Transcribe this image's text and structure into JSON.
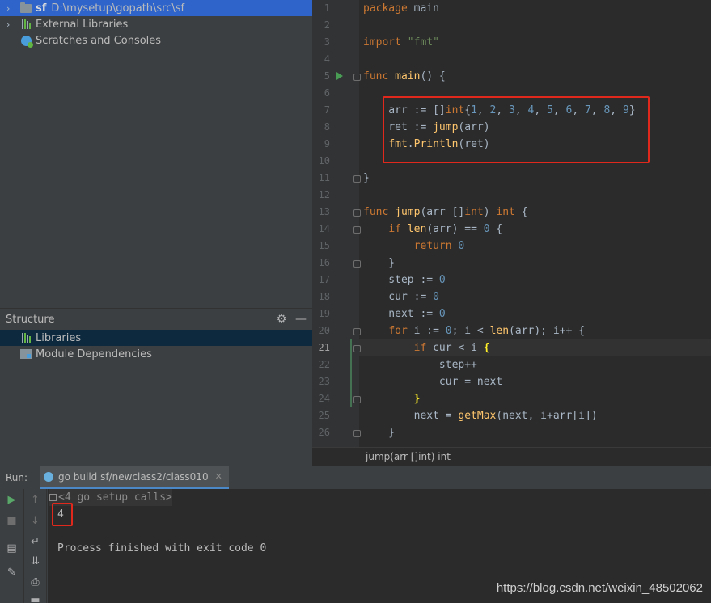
{
  "project": {
    "root_name": "sf",
    "root_path": "D:\\mysetup\\gopath\\src\\sf",
    "items": [
      "External Libraries",
      "Scratches and Consoles"
    ]
  },
  "structure": {
    "title": "Structure",
    "items": [
      "Libraries",
      "Module Dependencies"
    ]
  },
  "editor": {
    "line_numbers": [
      "1",
      "2",
      "3",
      "4",
      "5",
      "6",
      "7",
      "8",
      "9",
      "10",
      "11",
      "12",
      "13",
      "14",
      "15",
      "16",
      "17",
      "18",
      "19",
      "20",
      "21",
      "22",
      "23",
      "24",
      "25",
      "26"
    ],
    "current_line": 21
  },
  "breadcrumb": "jump(arr []int) int",
  "run": {
    "label": "Run:",
    "tab": "go build sf/newclass2/class010",
    "setup_calls": "<4 go setup calls>",
    "output_value": "4",
    "finish_message": "Process finished with exit code 0"
  },
  "watermark": "https://blog.csdn.net/weixin_48502062"
}
